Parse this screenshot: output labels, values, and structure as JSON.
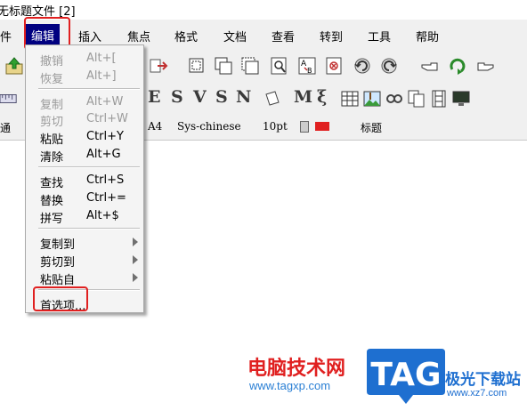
{
  "window": {
    "title": "无标题文件 [2]"
  },
  "menubar": {
    "items": [
      "件",
      "编辑",
      "插入",
      "焦点",
      "格式",
      "文档",
      "查看",
      "转到",
      "工具",
      "帮助"
    ],
    "active": "编辑"
  },
  "toolbar2": {
    "glyphs": [
      "E",
      "S",
      "V",
      "S",
      "N",
      "M",
      "ξ"
    ]
  },
  "format_bar": {
    "left_text": "通",
    "page_size": "A4",
    "font": "Sys-chinese",
    "font_size": "10pt",
    "style": "标题",
    "flag_color": "#e02020"
  },
  "edit_menu": {
    "undo": {
      "label": "撤销",
      "shortcut": "Alt+["
    },
    "redo": {
      "label": "恢复",
      "shortcut": "Alt+]"
    },
    "copy": {
      "label": "复制",
      "shortcut": "Alt+W"
    },
    "cut": {
      "label": "剪切",
      "shortcut": "Ctrl+W"
    },
    "paste": {
      "label": "粘贴",
      "shortcut": "Ctrl+Y"
    },
    "clear": {
      "label": "清除",
      "shortcut": "Alt+G"
    },
    "find": {
      "label": "查找",
      "shortcut": "Ctrl+S"
    },
    "replace": {
      "label": "替换",
      "shortcut": "Ctrl+="
    },
    "spell": {
      "label": "拼写",
      "shortcut": "Alt+$"
    },
    "copy_to": {
      "label": "复制到"
    },
    "cut_to": {
      "label": "剪切到"
    },
    "paste_from": {
      "label": "粘贴自"
    },
    "preferences": {
      "label": "首选项..."
    }
  },
  "watermark": {
    "text": "电脑技术网",
    "url": "www.tagxp.com",
    "logo": "TAG",
    "site": "极光下载站",
    "site_url": "www.xz7.com"
  },
  "colors": {
    "highlight": "#000080",
    "annotation": "#e02020",
    "watermark_blue": "#1e6fd0"
  }
}
